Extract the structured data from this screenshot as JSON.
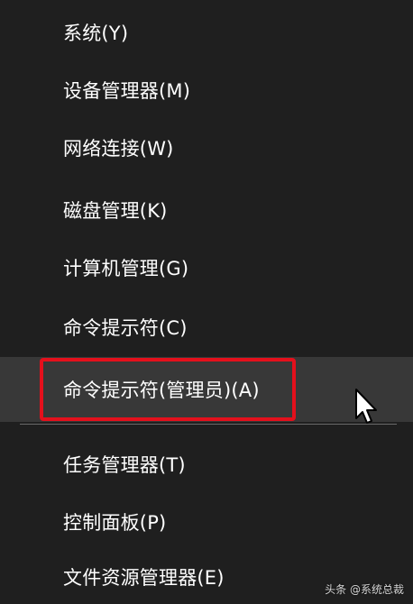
{
  "menu": {
    "items": [
      {
        "label": "系统(Y)"
      },
      {
        "label": "设备管理器(M)"
      },
      {
        "label": "网络连接(W)"
      },
      {
        "label": "磁盘管理(K)"
      },
      {
        "label": "计算机管理(G)"
      },
      {
        "label": "命令提示符(C)"
      },
      {
        "label": "命令提示符(管理员)(A)"
      },
      {
        "label": "任务管理器(T)"
      },
      {
        "label": "控制面板(P)"
      },
      {
        "label": "文件资源管理器(E)"
      }
    ]
  },
  "watermark": {
    "text": "头条 @系统总裁"
  },
  "colors": {
    "background": "#1f1f1f",
    "hover": "#383838",
    "highlight_border": "#e4101c",
    "text": "#ffffff"
  },
  "icons": {
    "cursor": "arrow-cursor-icon"
  }
}
